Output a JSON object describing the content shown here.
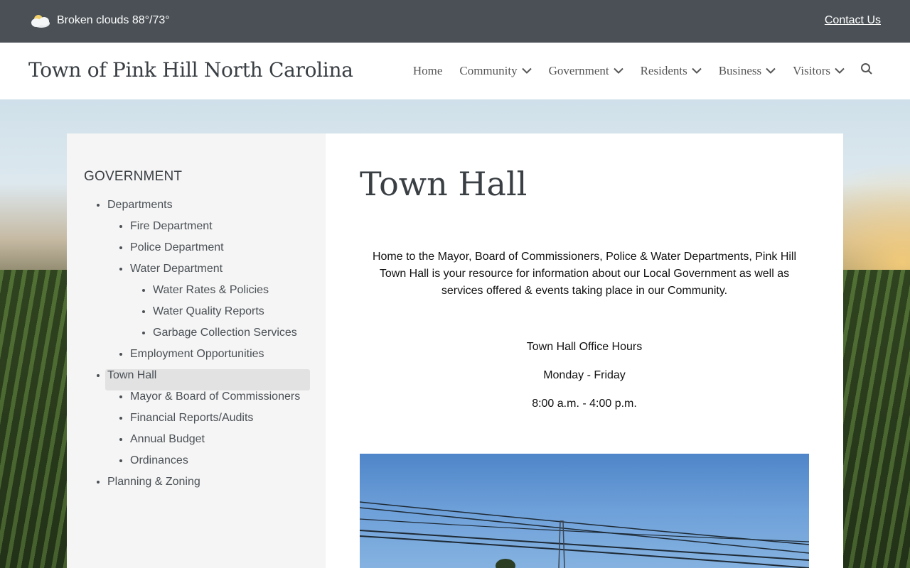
{
  "topbar": {
    "weather_icon": "cloud-sun-icon",
    "weather_text": "Broken clouds 88°/73°",
    "contact_label": "Contact Us"
  },
  "header": {
    "site_title": "Town of Pink Hill North Carolina",
    "nav": [
      {
        "label": "Home",
        "dropdown": false
      },
      {
        "label": "Community",
        "dropdown": true
      },
      {
        "label": "Government",
        "dropdown": true
      },
      {
        "label": "Residents",
        "dropdown": true
      },
      {
        "label": "Business",
        "dropdown": true
      },
      {
        "label": "Visitors",
        "dropdown": true
      }
    ],
    "search_icon": "search-icon"
  },
  "sidebar": {
    "heading": "GOVERNMENT",
    "items": {
      "departments": "Departments",
      "fire": "Fire Department",
      "police": "Police Department",
      "water": "Water Department",
      "water_rates": "Water Rates & Policies",
      "water_quality": "Water Quality Reports",
      "garbage": "Garbage Collection Services",
      "employment": "Employment Opportunities",
      "town_hall": "Town Hall",
      "mayor": "Mayor & Board of Commissioners",
      "financial": "Financial Reports/Audits",
      "budget": "Annual Budget",
      "ordinances": "Ordinances",
      "planning": "Planning & Zoning"
    },
    "active": "Town Hall"
  },
  "main": {
    "title": "Town Hall",
    "intro": "Home to the Mayor, Board of Commissioners, Police & Water Departments, Pink Hill Town Hall is your resource for information about our Local Government as well as services offered & events taking place in our Community.",
    "hours_title": "Town Hall Office Hours",
    "hours_days": "Monday - Friday",
    "hours_time": "8:00 a.m. - 4:00 p.m."
  },
  "colors": {
    "topbar_bg": "#4a5055",
    "sidebar_bg": "#f5f5f5",
    "active_item_bg": "#e2e2e2"
  }
}
